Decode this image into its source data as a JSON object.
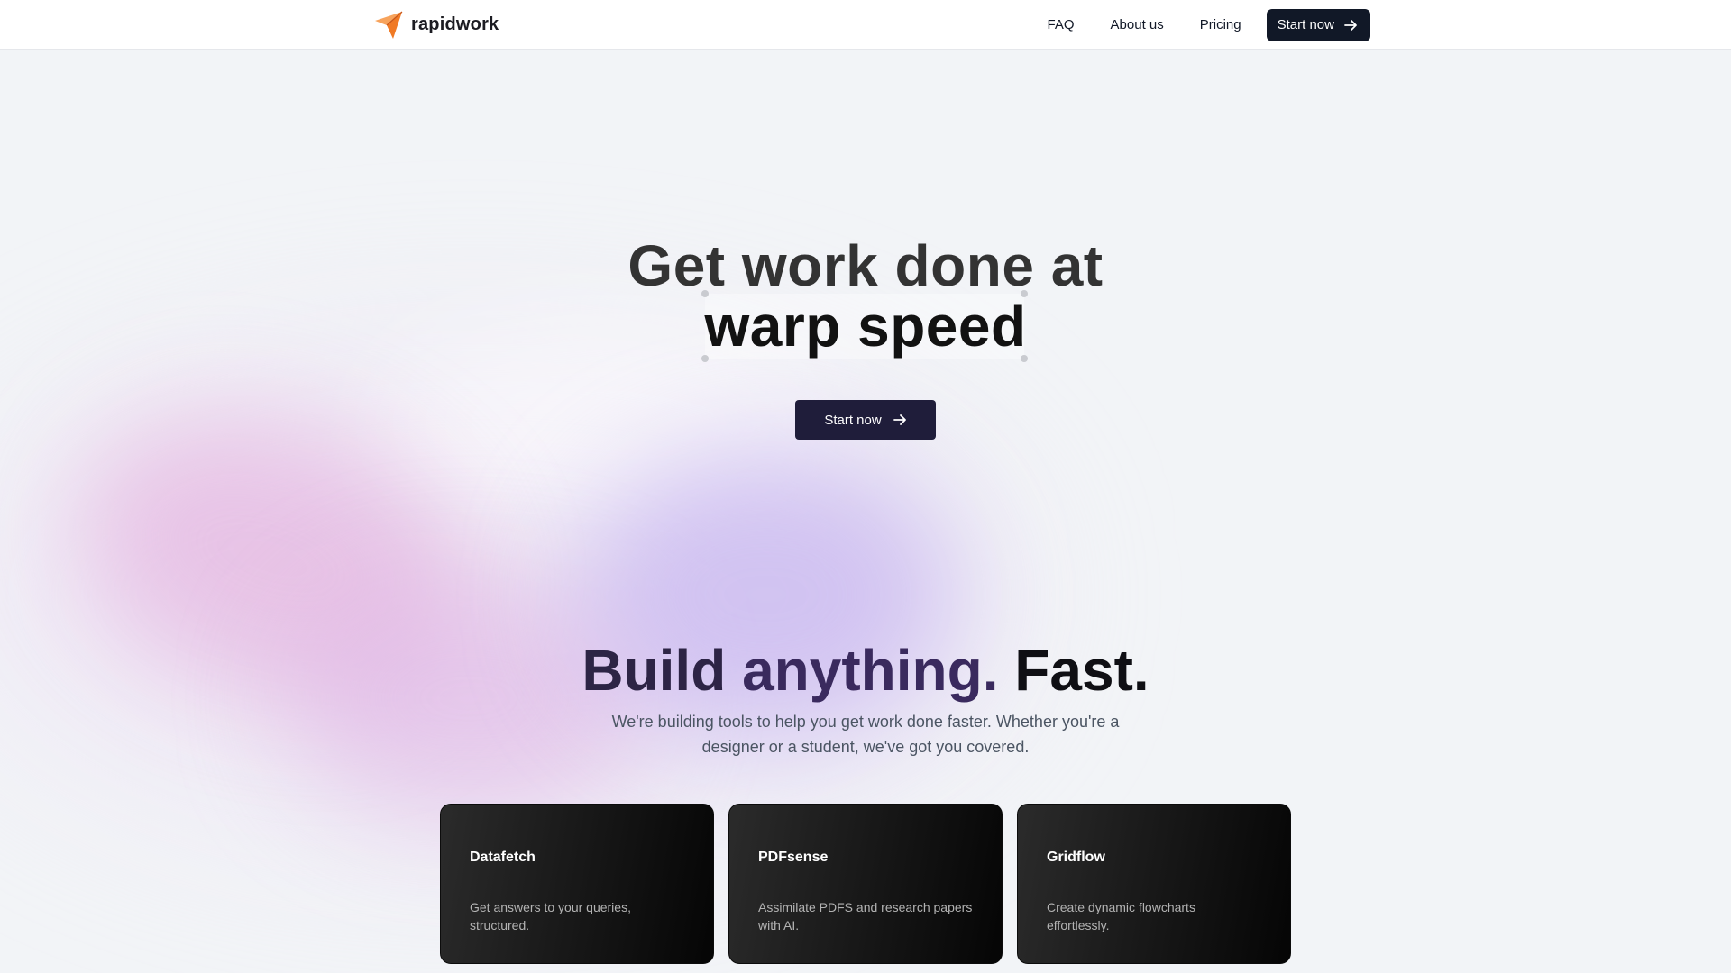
{
  "brand": {
    "name": "rapidwork",
    "icon": "paper-plane-icon",
    "icon_color": "#f07a25"
  },
  "nav": {
    "links": [
      "FAQ",
      "About us",
      "Pricing"
    ],
    "cta_label": "Start now",
    "cta_icon": "arrow-right-icon"
  },
  "hero": {
    "line1": "Get work done at",
    "line2": "warp speed",
    "cta_label": "Start now",
    "cta_icon": "arrow-right-icon"
  },
  "features": {
    "title_parts": [
      "Build",
      "anything.",
      "Fast."
    ],
    "subtitle_lines": [
      "We're building tools to help you get work done faster. Whether you're a",
      "designer or a student, we've got you covered."
    ],
    "cards": [
      {
        "title": "Datafetch",
        "description": "Get answers to your queries, structured."
      },
      {
        "title": "PDFsense",
        "description": "Assimilate PDFS and research papers with AI."
      },
      {
        "title": "Gridflow",
        "description": "Create dynamic flowcharts effortlessly."
      }
    ]
  },
  "colors": {
    "page_background": "#f2f4f7",
    "button_dark": "#111827",
    "hero_button": "#1f1d3a",
    "accent_pink": "#e2aadc",
    "accent_violet": "#c4b2f0"
  }
}
